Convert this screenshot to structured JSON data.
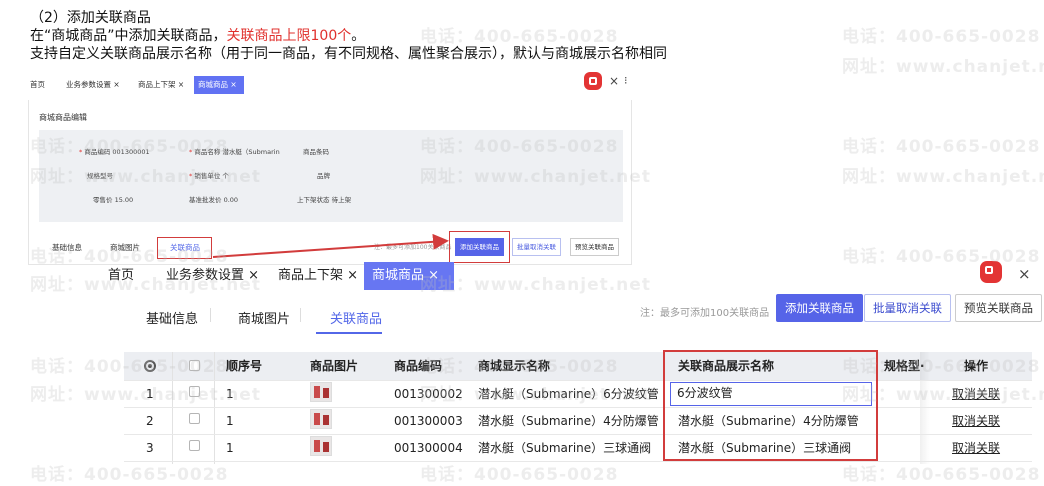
{
  "instructions": {
    "heading": "（2）添加关联商品",
    "line1_prefix": "在“商城商品”中添加关联商品，",
    "line1_red": "关联商品上限100个",
    "line1_suffix": "。",
    "line2": "支持自定义关联商品展示名称（用于同一商品，有不同规格、属性聚合展示），默认与商城展示名称相同"
  },
  "watermark": {
    "phone": "电话：400-665-0028",
    "site": "网址：www.chanjet.net"
  },
  "small": {
    "tabs": [
      "首页",
      "业务参数设置 ×",
      "商品上下架 ×",
      "商城商品 ×"
    ],
    "close": "×",
    "more": "⁝",
    "panel_title": "商城商品编辑",
    "form": {
      "code_label": "商品编码",
      "code_value": "001300001",
      "name_label": "商品名称",
      "name_value": "潜水艇（Submarin",
      "barcode_label": "商品条码",
      "spec_label": "规格型号",
      "unit_label": "销售单位",
      "unit_value": "个",
      "brand_label": "品牌",
      "retail_label": "零售价",
      "retail_value": "15.00",
      "batch_label": "基准批发价",
      "batch_value": "0.00",
      "status_label": "上下架状态",
      "status_value": "待上架"
    },
    "subtabs": [
      "基础信息",
      "商城图片",
      "关联商品"
    ],
    "note": "注：最多可添加100关联商品",
    "buttons": [
      "添加关联商品",
      "批量取消关联",
      "预览关联商品"
    ]
  },
  "big": {
    "tabs": [
      "首页",
      "业务参数设置 ×",
      "商品上下架 ×",
      "商城商品 ×"
    ],
    "close": "×",
    "subtabs": [
      "基础信息",
      "商城图片",
      "关联商品"
    ],
    "note": "注：最多可添加100关联商品",
    "buttons": {
      "add": "添加关联商品",
      "batch_cancel": "批量取消关联",
      "preview": "预览关联商品"
    },
    "columns": {
      "seq": "顺序号",
      "image": "商品图片",
      "code": "商品编码",
      "mall_name": "商城显示名称",
      "display_name": "关联商品展示名称",
      "spec": "规格型·",
      "ops": "操作"
    },
    "rows": [
      {
        "index": "1",
        "seq": "1",
        "code": "001300002",
        "mall_name": "潜水艇（Submarine）6分波纹管",
        "display_name": "6分波纹管",
        "op": "取消关联"
      },
      {
        "index": "2",
        "seq": "1",
        "code": "001300003",
        "mall_name": "潜水艇（Submarine）4分防爆管",
        "display_name": "潜水艇（Submarine）4分防爆管",
        "op": "取消关联"
      },
      {
        "index": "3",
        "seq": "1",
        "code": "001300004",
        "mall_name": "潜水艇（Submarine）三球通阀",
        "display_name": "潜水艇（Submarine）三球通阀",
        "op": "取消关联"
      }
    ]
  },
  "colors": {
    "accent": "#5664e8",
    "highlight_red": "#d23c3c",
    "logo_red": "#e33434"
  }
}
